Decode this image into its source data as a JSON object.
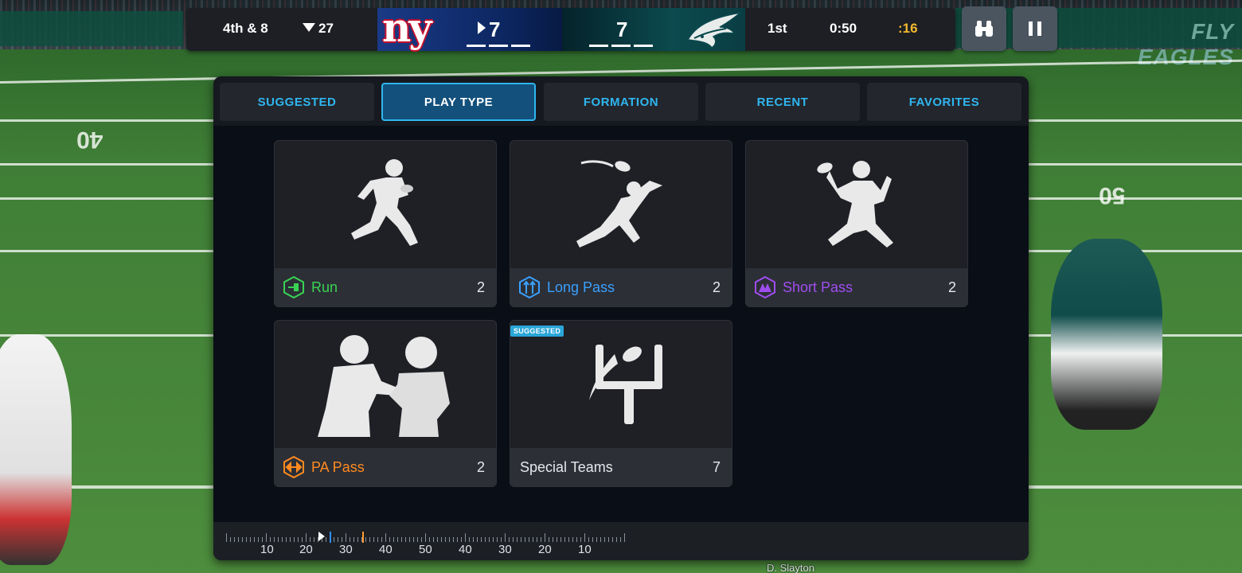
{
  "scoreboard": {
    "down_distance": "4th & 8",
    "ball_on": "27",
    "home_score": "7",
    "away_score": "7",
    "quarter": "1st",
    "game_clock": "0:50",
    "play_clock": ":16",
    "home_logo_text": "ny",
    "home_color": "#1a3a86",
    "away_color": "#0b4a4e",
    "play_clock_color": "#f5b82e"
  },
  "stadium": {
    "banner_text": "FLY EAGLES",
    "player_name_tag": "D. Slayton"
  },
  "top_buttons": {
    "binoculars_icon": "binoculars-icon",
    "pause_icon": "pause-icon"
  },
  "tabs": [
    {
      "label": "SUGGESTED",
      "active": false
    },
    {
      "label": "PLAY TYPE",
      "active": true
    },
    {
      "label": "FORMATION",
      "active": false
    },
    {
      "label": "RECENT",
      "active": false
    },
    {
      "label": "FAVORITES",
      "active": false
    }
  ],
  "play_types": [
    {
      "label": "Run",
      "count": "2",
      "color": "#39d353",
      "icon": "run-category-icon",
      "art": "running-player-silhouette"
    },
    {
      "label": "Long Pass",
      "count": "2",
      "color": "#3aa0ff",
      "icon": "long-pass-category-icon",
      "art": "diving-catch-silhouette"
    },
    {
      "label": "Short Pass",
      "count": "2",
      "color": "#a04df0",
      "icon": "short-pass-category-icon",
      "art": "quarterback-throw-silhouette"
    },
    {
      "label": "PA Pass",
      "count": "2",
      "color": "#ff8a1f",
      "icon": "pa-pass-category-icon",
      "art": "play-action-handoff-silhouette"
    },
    {
      "label": "Special Teams",
      "count": "7",
      "color": "#e6e8eb",
      "icon": "",
      "art": "goalpost-football-icon",
      "badge": "SUGGESTED"
    }
  ],
  "yard_meter": {
    "labels": [
      "10",
      "20",
      "30",
      "40",
      "50",
      "40",
      "30",
      "20",
      "10"
    ]
  },
  "field": {
    "yard_numbers": [
      "40",
      "50"
    ]
  }
}
